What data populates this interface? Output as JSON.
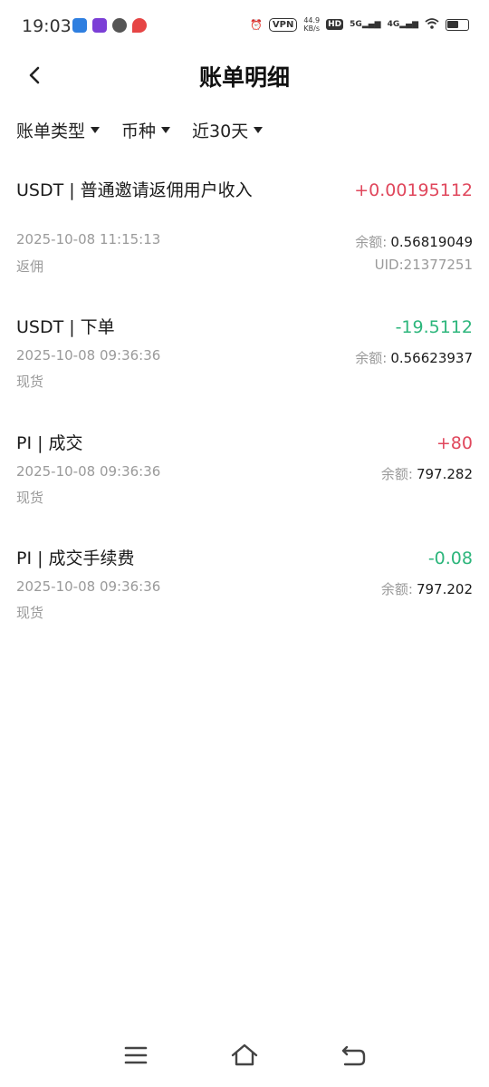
{
  "status_bar": {
    "time": "19:03",
    "vpn": "VPN",
    "speed_value": "44.9",
    "speed_unit": "KB/s",
    "hd": "HD",
    "sim1": "5G",
    "sim2": "4G"
  },
  "header": {
    "title": "账单明细"
  },
  "filters": [
    {
      "label": "账单类型"
    },
    {
      "label": "币种"
    },
    {
      "label": "近30天"
    }
  ],
  "balance_label": "余额:",
  "records": [
    {
      "title": "USDT | 普通邀请返佣用户收入",
      "amount": "+0.00195112",
      "time": "2025-10-08 11:15:13",
      "balance": "0.56819049",
      "type": "返佣",
      "uid": "UID:21377251"
    },
    {
      "title": "USDT | 下单",
      "amount": "-19.5112",
      "time": "2025-10-08 09:36:36",
      "balance": "0.56623937",
      "type": "现货"
    },
    {
      "title": "PI | 成交",
      "amount": "+80",
      "time": "2025-10-08 09:36:36",
      "balance": "797.282",
      "type": "现货"
    },
    {
      "title": "PI | 成交手续费",
      "amount": "-0.08",
      "time": "2025-10-08 09:36:36",
      "balance": "797.202",
      "type": "现货"
    }
  ],
  "colors": {
    "positive": "#e0475c",
    "negative": "#2db67c"
  },
  "icons": {
    "back": "back-arrow-icon",
    "menu": "menu-icon",
    "home": "home-icon",
    "return": "return-icon"
  }
}
